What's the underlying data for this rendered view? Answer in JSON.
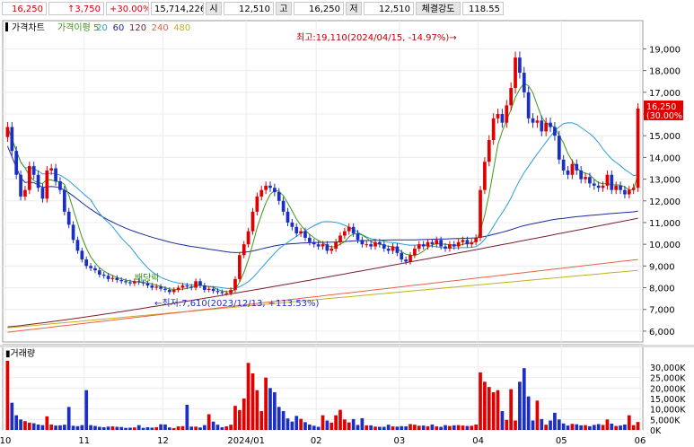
{
  "header": {
    "current_price": "16,250",
    "change": "↑3,750",
    "change_rate": "+30.00%",
    "volume": "15,714,226",
    "open_label": "시",
    "open_value": "12,510",
    "high_label": "고",
    "high_value": "16,250",
    "low_label": "저",
    "low_value": "12,510",
    "strength_label": "체결강도",
    "strength_value": "118.55"
  },
  "colors": {
    "up": "#e00000",
    "down": "#1c2fc4",
    "ma5": "#3a9a18",
    "ma20": "#2d9cd8",
    "ma60": "#1a2aa0",
    "ma120": "#7a1f2e",
    "ma240": "#e8604a",
    "ma480": "#c0b020"
  },
  "chart_data": {
    "type": "candlestick",
    "title": "가격차트",
    "legend": [
      {
        "name": "가격이평 5",
        "color": "#3a9a18"
      },
      {
        "name": "20",
        "color": "#2d9cd8"
      },
      {
        "name": "60",
        "color": "#1a2aa0"
      },
      {
        "name": "120",
        "color": "#7a1f2e"
      },
      {
        "name": "240",
        "color": "#e8604a"
      },
      {
        "name": "480",
        "color": "#c0b020"
      }
    ],
    "ylim": [
      5500,
      20300
    ],
    "yticks": [
      "19,000",
      "18,000",
      "17,000",
      "16,000",
      "15,000",
      "14,000",
      "13,000",
      "12,000",
      "11,000",
      "10,000",
      "9,000",
      "8,000",
      "7,000",
      "6,000"
    ],
    "ytick_values": [
      19000,
      18000,
      17000,
      16000,
      15000,
      14000,
      13000,
      12000,
      11000,
      10000,
      9000,
      8000,
      7000,
      6000
    ],
    "xticks": [
      "10",
      "11",
      "12",
      "2024/01",
      "02",
      "03",
      "04",
      "05",
      "06"
    ],
    "xtick_index": [
      0,
      18,
      36,
      55,
      71,
      90,
      108,
      127,
      145
    ],
    "annotations": {
      "high": "최고:19,110(2024/04/15, -14.97%)",
      "low": "←최저:7,610(2023/12/13, +113.53%)",
      "dividend": "배당락"
    },
    "last_price_label": "16,250",
    "last_price_rate": "(30.00%)",
    "closes": [
      15400,
      14300,
      13200,
      12200,
      12500,
      13600,
      13200,
      12600,
      12100,
      13400,
      13500,
      12900,
      12500,
      11500,
      10900,
      10200,
      9700,
      9300,
      9000,
      8900,
      8800,
      8600,
      8550,
      8400,
      8450,
      8350,
      8300,
      8250,
      8200,
      8300,
      8250,
      8200,
      8100,
      8000,
      8050,
      7950,
      7900,
      7800,
      7900,
      8000,
      8100,
      8050,
      8000,
      8300,
      8100,
      7900,
      7950,
      7850,
      7800,
      7750,
      7750,
      7900,
      8400,
      9500,
      10000,
      10600,
      11500,
      12200,
      12500,
      12700,
      12600,
      12400,
      12000,
      11500,
      11000,
      10800,
      10500,
      10600,
      10300,
      10100,
      10000,
      9900,
      10000,
      9700,
      9800,
      10100,
      10400,
      10600,
      10800,
      10500,
      10200,
      10000,
      10000,
      9900,
      10100,
      10000,
      9800,
      9700,
      9900,
      9600,
      9300,
      9200,
      9500,
      9800,
      10000,
      9900,
      10100,
      10000,
      10200,
      9900,
      9800,
      10000,
      9900,
      10100,
      10200,
      10000,
      10100,
      10300,
      12500,
      13800,
      14800,
      15800,
      16000,
      15600,
      16400,
      17200,
      18600,
      17900,
      17000,
      15800,
      15600,
      15700,
      15200,
      15600,
      15400,
      15000,
      13900,
      13400,
      13200,
      13700,
      13400,
      13000,
      13100,
      12800,
      12700,
      12600,
      12700,
      13200,
      12500,
      12700,
      12500,
      12300,
      12500,
      12600,
      16250
    ],
    "volume": {
      "label": "거래량",
      "ylim": [
        0,
        36000000
      ],
      "yticks": [
        "30,000K",
        "25,000K",
        "20,000K",
        "15,000K",
        "10,000K",
        "5,000K",
        "0K"
      ],
      "ytick_values": [
        30000000,
        25000000,
        20000000,
        15000000,
        10000000,
        5000000,
        0
      ],
      "values": [
        33000000,
        13000000,
        7000000,
        5000000,
        4200000,
        3500000,
        3200000,
        2600000,
        2300000,
        6500000,
        2600000,
        2100000,
        2200000,
        2500000,
        11000000,
        2000000,
        1800000,
        2300000,
        19000000,
        2300000,
        1900000,
        1500000,
        1300000,
        1600000,
        1700000,
        1500000,
        1400000,
        1000000,
        1100000,
        1200000,
        2300000,
        1000000,
        1300000,
        1100000,
        1300000,
        2700000,
        2600000,
        1200000,
        900000,
        1700000,
        1800000,
        12000000,
        1600000,
        1600000,
        1200000,
        2300000,
        7500000,
        4000000,
        2500000,
        1300000,
        1700000,
        2500000,
        11500000,
        9500000,
        15000000,
        32000000,
        27000000,
        19000000,
        9000000,
        25000000,
        20000000,
        18000000,
        11000000,
        9000000,
        5500000,
        4000000,
        6700000,
        5300000,
        3700000,
        2600000,
        2000000,
        1500000,
        7000000,
        4500000,
        3500000,
        7000000,
        9600000,
        5000000,
        3600000,
        5200000,
        2400000,
        5600000,
        2200000,
        2200000,
        1600000,
        1500000,
        1500000,
        2500000,
        1700000,
        1600000,
        1800000,
        1700000,
        2800000,
        2500000,
        2000000,
        2100000,
        1800000,
        2600000,
        1700000,
        1500000,
        2300000,
        1900000,
        2200000,
        2300000,
        2100000,
        1900000,
        2000000,
        2600000,
        27500000,
        23000000,
        20500000,
        18000000,
        19000000,
        9000000,
        4800000,
        19500000,
        4500000,
        23000000,
        29500000,
        16000000,
        4500000,
        14000000,
        5200000,
        2500000,
        4500000,
        8200000,
        5000000,
        3100000,
        2100000,
        2900000,
        2700000,
        2200000,
        2300000,
        1800000,
        2400000,
        2800000,
        2400000,
        5000000,
        3000000,
        1900000,
        2100000,
        2600000,
        7000000,
        2300000,
        3800000,
        17500000
      ]
    }
  }
}
